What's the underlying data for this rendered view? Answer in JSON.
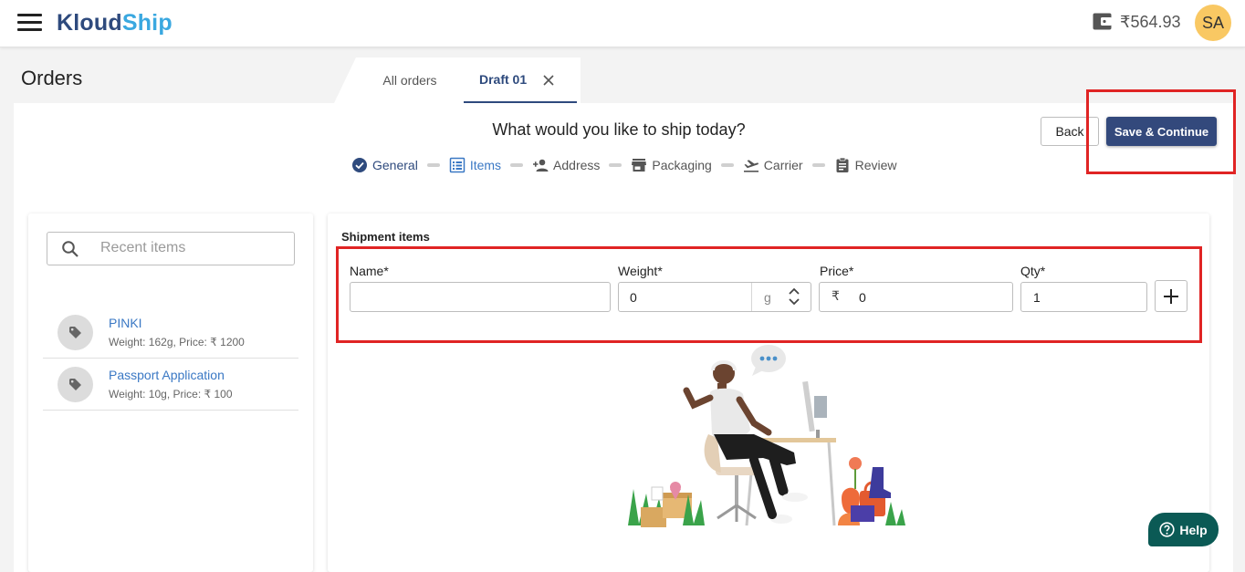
{
  "header": {
    "logo_part1": "Kloud",
    "logo_part2": "Ship",
    "wallet_balance": "₹564.93",
    "avatar_initials": "SA"
  },
  "page": {
    "title": "Orders",
    "tabs": [
      {
        "label": "All orders",
        "active": false
      },
      {
        "label": "Draft 01",
        "active": true,
        "closable": true
      }
    ]
  },
  "wizard": {
    "question": "What would you like to ship today?",
    "back_label": "Back",
    "save_label": "Save & Continue",
    "steps": [
      {
        "label": "General",
        "icon": "check-circle-icon",
        "state": "done"
      },
      {
        "label": "Items",
        "icon": "list-icon",
        "state": "active"
      },
      {
        "label": "Address",
        "icon": "person-add-icon",
        "state": "pending"
      },
      {
        "label": "Packaging",
        "icon": "store-icon",
        "state": "pending"
      },
      {
        "label": "Carrier",
        "icon": "flight-takeoff-icon",
        "state": "pending"
      },
      {
        "label": "Review",
        "icon": "clipboard-icon",
        "state": "pending"
      }
    ]
  },
  "recent": {
    "search_placeholder": "Recent items",
    "items": [
      {
        "name": "PINKI",
        "meta": "Weight: 162g, Price: ₹ 1200"
      },
      {
        "name": "Passport Application",
        "meta": "Weight: 10g, Price: ₹ 100"
      }
    ]
  },
  "shipment": {
    "title": "Shipment items",
    "name_label": "Name*",
    "name_value": "",
    "weight_label": "Weight*",
    "weight_value": "0",
    "weight_unit": "g",
    "price_label": "Price*",
    "price_currency": "₹",
    "price_value": "0",
    "qty_label": "Qty*",
    "qty_value": "1"
  },
  "help": {
    "label": "Help"
  },
  "colors": {
    "brand_dark": "#2e4a7d",
    "brand_light": "#3aa8e0",
    "primary_button": "#33497c",
    "highlight": "#e02424",
    "help_bg": "#0b5a55",
    "avatar_bg": "#f9c863"
  }
}
